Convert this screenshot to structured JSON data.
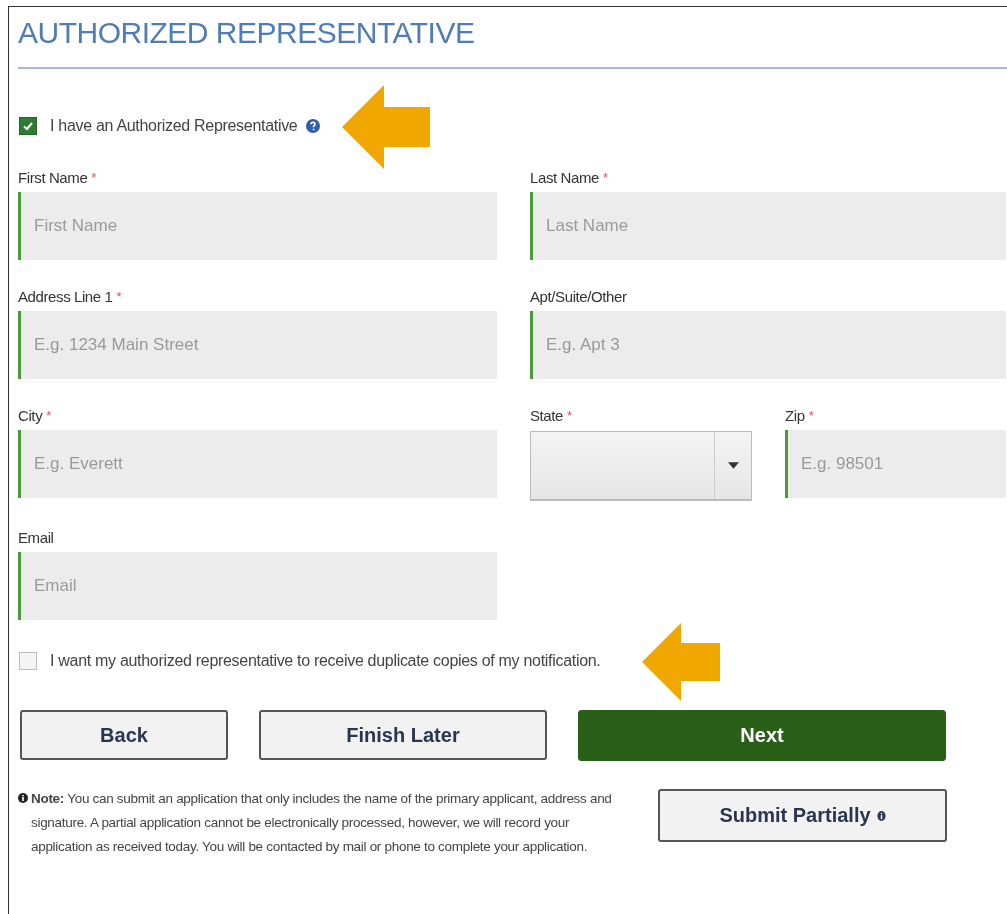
{
  "title": "AUTHORIZED REPRESENTATIVE",
  "has_representative": {
    "label": "I have an Authorized Representative",
    "checked": true
  },
  "rows": [
    [
      {
        "label": "First Name",
        "required": true,
        "kind": "text",
        "placeholder": "First Name"
      },
      {
        "label": "Last Name",
        "required": true,
        "kind": "text",
        "placeholder": "Last Name"
      }
    ],
    [
      {
        "label": "Address Line 1",
        "required": true,
        "kind": "text",
        "placeholder": "E.g. 1234 Main Street"
      },
      {
        "label": "Apt/Suite/Other",
        "required": false,
        "kind": "text",
        "placeholder": "E.g. Apt 3"
      }
    ],
    [
      {
        "label": "City",
        "required": true,
        "kind": "text",
        "placeholder": "E.g. Everett"
      },
      {
        "label": "State",
        "required": true,
        "kind": "select"
      },
      {
        "label": "Zip",
        "required": true,
        "kind": "text",
        "placeholder": "E.g. 98501"
      }
    ],
    [
      {
        "label": "Email",
        "required": false,
        "kind": "text",
        "placeholder": "Email"
      }
    ]
  ],
  "required_mark": "*",
  "duplicate_copies": {
    "label": "I want my authorized representative to receive duplicate copies of my notification.",
    "checked": false
  },
  "buttons": [
    {
      "label": "Back",
      "kind": "secondary"
    },
    {
      "label": "Finish Later",
      "kind": "secondary"
    },
    {
      "label": "Next",
      "kind": "primary"
    }
  ],
  "note": "**Note:** You can submit an application that only includes the name of the primary applicant, address and signature. A partial application cannot be electronically processed, however, we will record your application as received today. You will be contacted by mail or phone to complete your application.",
  "submit_partially": {
    "label": "Submit Partially"
  }
}
